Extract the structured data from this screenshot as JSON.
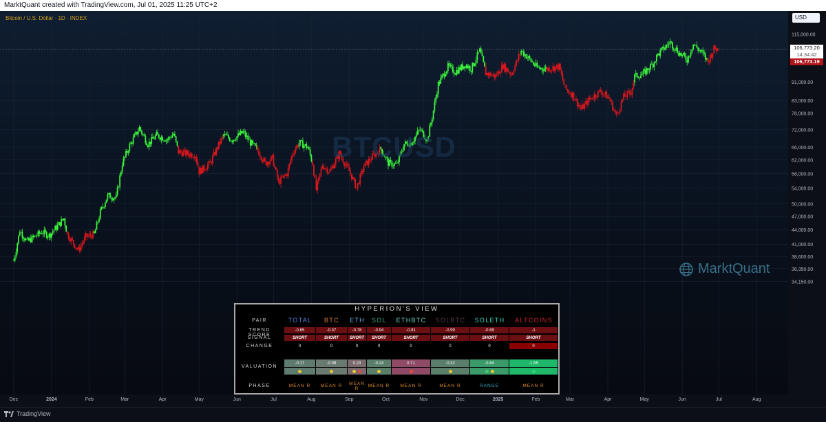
{
  "header": {
    "text": "MarktQuant created with TradingView.com, Jul 01, 2025 11:25 UTC+2"
  },
  "legend": {
    "label": "Bitcoin / U.S. Dollar · 1D · INDEX"
  },
  "watermarks": {
    "ticker": "BTCUSD",
    "brand": "MarktQuant"
  },
  "price_scale": {
    "currency": "USD",
    "last_price": "106,773.20",
    "countdown": "14:34:42",
    "marker_price": "106,773.19"
  },
  "footer": {
    "brand": "TradingView"
  },
  "colors": {
    "bull": "#3cf53c",
    "bear": "#d8171d",
    "background": "#0c1016",
    "accent": "#d7a21c"
  },
  "chart_data": {
    "type": "line",
    "series": [
      {
        "points": [
          {
            "x": "2023-12-01",
            "y": 37800,
            "trend": "bull"
          },
          {
            "x": "2023-12-06",
            "y": 43800,
            "trend": "bull"
          },
          {
            "x": "2023-12-12",
            "y": 41500,
            "trend": "bull"
          },
          {
            "x": "2023-12-18",
            "y": 42500,
            "trend": "bull"
          },
          {
            "x": "2023-12-24",
            "y": 43500,
            "trend": "bull"
          },
          {
            "x": "2023-12-30",
            "y": 42800,
            "trend": "bull"
          },
          {
            "x": "2024-01-05",
            "y": 44500,
            "trend": "bull"
          },
          {
            "x": "2024-01-11",
            "y": 46500,
            "trend": "bull"
          },
          {
            "x": "2024-01-14",
            "y": 43000,
            "trend": "bear"
          },
          {
            "x": "2024-01-18",
            "y": 41500,
            "trend": "bear"
          },
          {
            "x": "2024-01-23",
            "y": 39800,
            "trend": "bear"
          },
          {
            "x": "2024-01-29",
            "y": 42500,
            "trend": "bear"
          },
          {
            "x": "2024-02-05",
            "y": 43000,
            "trend": "bull"
          },
          {
            "x": "2024-02-10",
            "y": 48000,
            "trend": "bull"
          },
          {
            "x": "2024-02-16",
            "y": 52000,
            "trend": "bull"
          },
          {
            "x": "2024-02-23",
            "y": 51500,
            "trend": "bull"
          },
          {
            "x": "2024-02-28",
            "y": 61000,
            "trend": "bull"
          },
          {
            "x": "2024-03-05",
            "y": 66500,
            "trend": "bull"
          },
          {
            "x": "2024-03-13",
            "y": 72500,
            "trend": "bull"
          },
          {
            "x": "2024-03-20",
            "y": 67000,
            "trend": "bull"
          },
          {
            "x": "2024-03-27",
            "y": 70000,
            "trend": "bull"
          },
          {
            "x": "2024-04-05",
            "y": 68500,
            "trend": "bull"
          },
          {
            "x": "2024-04-10",
            "y": 70500,
            "trend": "bull"
          },
          {
            "x": "2024-04-14",
            "y": 64500,
            "trend": "bear"
          },
          {
            "x": "2024-04-20",
            "y": 64000,
            "trend": "bear"
          },
          {
            "x": "2024-04-28",
            "y": 63500,
            "trend": "bear"
          },
          {
            "x": "2024-05-01",
            "y": 58500,
            "trend": "bear"
          },
          {
            "x": "2024-05-10",
            "y": 61000,
            "trend": "bear"
          },
          {
            "x": "2024-05-16",
            "y": 66000,
            "trend": "bear"
          },
          {
            "x": "2024-05-21",
            "y": 70000,
            "trend": "bull"
          },
          {
            "x": "2024-05-28",
            "y": 68500,
            "trend": "bull"
          },
          {
            "x": "2024-06-06",
            "y": 71000,
            "trend": "bull"
          },
          {
            "x": "2024-06-12",
            "y": 67500,
            "trend": "bull"
          },
          {
            "x": "2024-06-18",
            "y": 65000,
            "trend": "bear"
          },
          {
            "x": "2024-06-24",
            "y": 61000,
            "trend": "bear"
          },
          {
            "x": "2024-06-30",
            "y": 62500,
            "trend": "bear"
          },
          {
            "x": "2024-07-05",
            "y": 55500,
            "trend": "bear"
          },
          {
            "x": "2024-07-12",
            "y": 58000,
            "trend": "bear"
          },
          {
            "x": "2024-07-17",
            "y": 64500,
            "trend": "bear"
          },
          {
            "x": "2024-07-22",
            "y": 67500,
            "trend": "bull"
          },
          {
            "x": "2024-07-29",
            "y": 66000,
            "trend": "bull"
          },
          {
            "x": "2024-08-02",
            "y": 61000,
            "trend": "bear"
          },
          {
            "x": "2024-08-05",
            "y": 53500,
            "trend": "bear"
          },
          {
            "x": "2024-08-10",
            "y": 60500,
            "trend": "bear"
          },
          {
            "x": "2024-08-16",
            "y": 58500,
            "trend": "bear"
          },
          {
            "x": "2024-08-24",
            "y": 64000,
            "trend": "bear"
          },
          {
            "x": "2024-09-02",
            "y": 58000,
            "trend": "bear"
          },
          {
            "x": "2024-09-07",
            "y": 54000,
            "trend": "bear"
          },
          {
            "x": "2024-09-13",
            "y": 60000,
            "trend": "bear"
          },
          {
            "x": "2024-09-20",
            "y": 63000,
            "trend": "bear"
          },
          {
            "x": "2024-09-27",
            "y": 65500,
            "trend": "bull"
          },
          {
            "x": "2024-10-03",
            "y": 61000,
            "trend": "bull"
          },
          {
            "x": "2024-10-10",
            "y": 60500,
            "trend": "bull"
          },
          {
            "x": "2024-10-16",
            "y": 67000,
            "trend": "bull"
          },
          {
            "x": "2024-10-22",
            "y": 67500,
            "trend": "bull"
          },
          {
            "x": "2024-10-29",
            "y": 72000,
            "trend": "bull"
          },
          {
            "x": "2024-11-04",
            "y": 68500,
            "trend": "bull"
          },
          {
            "x": "2024-11-08",
            "y": 76500,
            "trend": "bull"
          },
          {
            "x": "2024-11-13",
            "y": 90000,
            "trend": "bull"
          },
          {
            "x": "2024-11-21",
            "y": 98000,
            "trend": "bull"
          },
          {
            "x": "2024-11-27",
            "y": 95500,
            "trend": "bull"
          },
          {
            "x": "2024-12-05",
            "y": 99000,
            "trend": "bull"
          },
          {
            "x": "2024-12-10",
            "y": 97000,
            "trend": "bull"
          },
          {
            "x": "2024-12-17",
            "y": 106000,
            "trend": "bull"
          },
          {
            "x": "2024-12-22",
            "y": 95000,
            "trend": "bear"
          },
          {
            "x": "2024-12-30",
            "y": 93500,
            "trend": "bear"
          },
          {
            "x": "2025-01-05",
            "y": 98500,
            "trend": "bear"
          },
          {
            "x": "2025-01-12",
            "y": 94500,
            "trend": "bear"
          },
          {
            "x": "2025-01-20",
            "y": 106000,
            "trend": "bull"
          },
          {
            "x": "2025-01-27",
            "y": 101500,
            "trend": "bull"
          },
          {
            "x": "2025-02-02",
            "y": 97500,
            "trend": "bull"
          },
          {
            "x": "2025-02-10",
            "y": 97000,
            "trend": "bear"
          },
          {
            "x": "2025-02-20",
            "y": 98000,
            "trend": "bear"
          },
          {
            "x": "2025-02-25",
            "y": 88000,
            "trend": "bear"
          },
          {
            "x": "2025-03-03",
            "y": 85500,
            "trend": "bear"
          },
          {
            "x": "2025-03-10",
            "y": 79500,
            "trend": "bear"
          },
          {
            "x": "2025-03-17",
            "y": 83500,
            "trend": "bear"
          },
          {
            "x": "2025-03-26",
            "y": 87000,
            "trend": "bear"
          },
          {
            "x": "2025-04-02",
            "y": 84000,
            "trend": "bear"
          },
          {
            "x": "2025-04-08",
            "y": 77000,
            "trend": "bear"
          },
          {
            "x": "2025-04-14",
            "y": 84500,
            "trend": "bear"
          },
          {
            "x": "2025-04-20",
            "y": 86500,
            "trend": "bear"
          },
          {
            "x": "2025-04-23",
            "y": 93500,
            "trend": "bull"
          },
          {
            "x": "2025-04-30",
            "y": 94500,
            "trend": "bull"
          },
          {
            "x": "2025-05-08",
            "y": 99500,
            "trend": "bull"
          },
          {
            "x": "2025-05-12",
            "y": 104000,
            "trend": "bull"
          },
          {
            "x": "2025-05-22",
            "y": 110500,
            "trend": "bull"
          },
          {
            "x": "2025-05-30",
            "y": 104500,
            "trend": "bull"
          },
          {
            "x": "2025-06-05",
            "y": 101500,
            "trend": "bull"
          },
          {
            "x": "2025-06-10",
            "y": 109500,
            "trend": "bull"
          },
          {
            "x": "2025-06-17",
            "y": 105000,
            "trend": "bull"
          },
          {
            "x": "2025-06-22",
            "y": 100500,
            "trend": "bear"
          },
          {
            "x": "2025-06-27",
            "y": 107000,
            "trend": "bear"
          },
          {
            "x": "2025-07-01",
            "y": 106773,
            "trend": "bear"
          }
        ]
      }
    ],
    "y_ticks": [
      "115,000.00",
      "91,000.00",
      "83,000.00",
      "78,000.00",
      "72,000.00",
      "66,000.00",
      "62,000.00",
      "58,000.00",
      "54,000.00",
      "50,000.00",
      "47,000.00",
      "44,000.00",
      "41,000.00",
      "38,600.00",
      "36,350.00",
      "34,150.00"
    ],
    "x_ticks": [
      "Dec",
      "2024",
      "Feb",
      "Mar",
      "Apr",
      "May",
      "Jun",
      "Jul",
      "Aug",
      "Sep",
      "Oct",
      "Nov",
      "Dec",
      "2025",
      "Feb",
      "Mar",
      "Apr",
      "May",
      "Jun",
      "Jul",
      "Aug"
    ],
    "ylim": [
      33500,
      118000
    ],
    "log_scale": true,
    "grid": true
  },
  "hyperion": {
    "title": "HYPERION'S VIEW",
    "row_labels": {
      "pair": "PAIR",
      "trend": "TREND SCORE",
      "signal": "SIGNAL",
      "change": "CHANGE",
      "valuation": "VALUATION",
      "phase": "PHASE"
    },
    "columns": [
      {
        "pair": "TOTAL",
        "pair_color": "#5b7ee5",
        "trend": "-0.65",
        "signal": "SHORT",
        "change": "0",
        "valuation": "-0.17",
        "val_color": "#5f7a6e",
        "dot1": "#e8c832",
        "dot2": "",
        "phase": "MEAN R",
        "change_color": "#000000"
      },
      {
        "pair": "BTC",
        "pair_color": "#e07b39",
        "trend": "-0.37",
        "signal": "SHORT",
        "change": "0",
        "valuation": "-0.08",
        "val_color": "#6a7a70",
        "dot1": "#e8c832",
        "dot2": "",
        "phase": "MEAN R",
        "change_color": "#000000"
      },
      {
        "pair": "ETH",
        "pair_color": "#6ab4e8",
        "trend": "-0.78",
        "signal": "SHORT",
        "change": "0",
        "valuation": "0.23",
        "val_color": "#7a6a6e",
        "dot1": "#e8c832",
        "dot2": "#e84a3a",
        "phase": "MEAN R",
        "change_color": "#000000"
      },
      {
        "pair": "SOL",
        "pair_color": "#3aa67a",
        "trend": "-0.94",
        "signal": "SHORT",
        "change": "0",
        "valuation": "-0.24",
        "val_color": "#5a7e6a",
        "dot1": "#e8c832",
        "dot2": "",
        "phase": "MEAN R",
        "change_color": "#000000"
      },
      {
        "pair": "ETHBTC",
        "pair_color": "#6ad8c8",
        "trend": "-0.81",
        "signal": "SHORT",
        "change": "0",
        "valuation": "0.71",
        "val_color": "#8e4a66",
        "dot1": "#e84a3a",
        "dot2": "",
        "phase": "MEAN R",
        "change_color": "#000000"
      },
      {
        "pair": "SOLBTC",
        "pair_color": "#5a3a4a",
        "trend": "-0.99",
        "signal": "SHORT",
        "change": "0",
        "valuation": "-0.32",
        "val_color": "#5a7e6a",
        "dot1": "#e8c832",
        "dot2": "",
        "phase": "MEAN R",
        "change_color": "#000000"
      },
      {
        "pair": "SOLETH",
        "pair_color": "#3ad8c0",
        "trend": "-0.89",
        "signal": "SHORT",
        "change": "0",
        "valuation": "-0.84",
        "val_color": "#3a9a6a",
        "dot1": "#4ac86a",
        "dot2": "#e8c832",
        "phase": "RANGE",
        "change_color": "#000000"
      },
      {
        "pair": "ALTCOINS",
        "pair_color": "#d8232a",
        "trend": "-1",
        "signal": "SHORT",
        "change": "0",
        "valuation": "-1.55",
        "val_color": "#1fb86a",
        "dot1": "#2ad86a",
        "dot2": "",
        "phase": "MEAN R",
        "change_color": "#8b0000"
      }
    ]
  }
}
